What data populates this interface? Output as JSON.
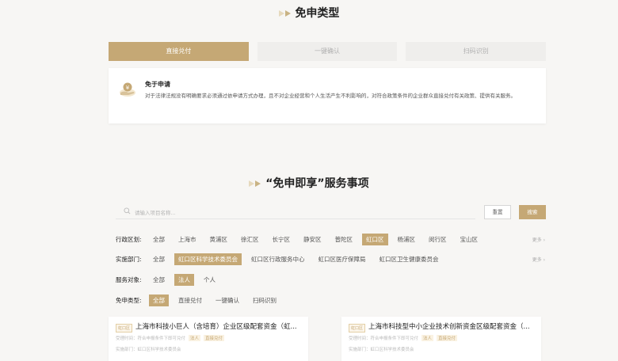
{
  "section1": {
    "title": "免申类型"
  },
  "tabs": [
    {
      "label": "直接兑付",
      "active": true
    },
    {
      "label": "一键确认",
      "active": false
    },
    {
      "label": "扫码识别",
      "active": false
    }
  ],
  "description": {
    "title": "免于申请",
    "text": "对于法律法规没有明确要求必须通过依申请方式办理，且不对企业经营和个人生活产生不利影响的，对符合政策条件的企业群众直接兑付有关政策、提供有关服务。"
  },
  "section2": {
    "title": "“免申即享”服务事项"
  },
  "search": {
    "placeholder": "请输入项目名称...",
    "reset_label": "重置",
    "search_label": "搜索"
  },
  "filters": {
    "district": {
      "label": "行政区划:",
      "options": [
        "全部",
        "上海市",
        "黄浦区",
        "徐汇区",
        "长宁区",
        "静安区",
        "普陀区",
        "虹口区",
        "杨浦区",
        "闵行区",
        "宝山区"
      ],
      "selected": 7,
      "more": "更多 ›"
    },
    "department": {
      "label": "实施部门:",
      "options": [
        "全部",
        "虹口区科学技术委员会",
        "虹口区行政服务中心",
        "虹口区医疗保障局",
        "虹口区卫生健康委员会"
      ],
      "selected": 1,
      "more": "更多 ›"
    },
    "target": {
      "label": "服务对象:",
      "options": [
        "全部",
        "法人",
        "个人"
      ],
      "selected": 1
    },
    "type": {
      "label": "免申类型:",
      "options": [
        "全部",
        "直接兑付",
        "一键确认",
        "扫码识别"
      ],
      "selected": 0
    }
  },
  "results": [
    {
      "tag": "虹口区",
      "title": "上海市科技小巨人（含培育）企业区级配套资金（虹...",
      "meta": "受理时间：符合申报条件下即可兑付",
      "b1": "法人",
      "b2": "直接兑付",
      "dept": "实施部门：虹口区科学技术委员会"
    },
    {
      "tag": "虹口区",
      "title": "上海市科技型中小企业技术创新资金区级配套资金（...",
      "meta": "受理时间：符合申报条件下即可兑付",
      "b1": "法人",
      "b2": "直接兑付",
      "dept": "实施部门：虹口区科学技术委员会"
    }
  ],
  "colors": {
    "accent": "#c5a875",
    "background": "#f7f6f4"
  }
}
